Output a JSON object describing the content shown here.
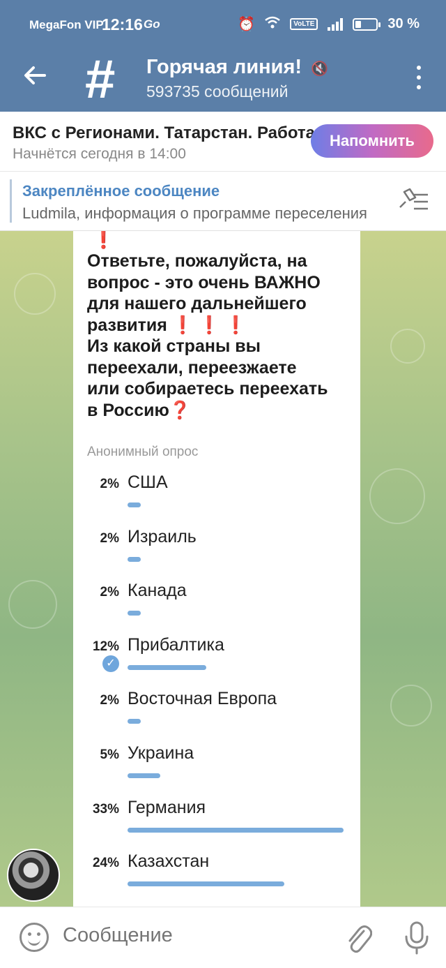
{
  "status": {
    "carrier": "MegaFon VIP",
    "time": "12:16",
    "extra": "Go",
    "volte": "VoLTE",
    "battery": "30 %"
  },
  "header": {
    "title": "Горячая линия!",
    "subtitle": "593735 сообщений"
  },
  "event": {
    "title": "ВКС с Регионами. Татарстан. Работа",
    "time": "Начнётся сегодня в 14:00",
    "remind_label": "Напомнить"
  },
  "pinned": {
    "label": "Закреплённое сообщение",
    "text": "Ludmila, информация о программе переселения"
  },
  "poll": {
    "question_line1": "Ответьте, пожалуйста, на",
    "question_line2": "вопрос - это очень  ВАЖНО",
    "question_line3": "для нашего дальнейшего",
    "question_line4": "развития",
    "question_line5": "Из какой страны вы",
    "question_line6": "переехали, переезжаете",
    "question_line7": "или собираетесь переехать",
    "question_line8": "в Россию",
    "type": "Анонимный опрос",
    "options": [
      {
        "label": "США",
        "percent": "2%",
        "value": 0.02
      },
      {
        "label": "Израиль",
        "percent": "2%",
        "value": 0.02
      },
      {
        "label": "Канада",
        "percent": "2%",
        "value": 0.02
      },
      {
        "label": "Прибалтика",
        "percent": "12%",
        "value": 0.12,
        "chosen": true
      },
      {
        "label": "Восточная Европа",
        "percent": "2%",
        "value": 0.02
      },
      {
        "label": "Украина",
        "percent": "5%",
        "value": 0.05
      },
      {
        "label": "Германия",
        "percent": "33%",
        "value": 0.33
      },
      {
        "label": "Казахстан",
        "percent": "24%",
        "value": 0.24
      }
    ]
  },
  "composer": {
    "placeholder": "Сообщение"
  },
  "colors": {
    "header": "#5b7fa8",
    "accent": "#4c86c2",
    "poll_bar": "#7aacdc"
  }
}
